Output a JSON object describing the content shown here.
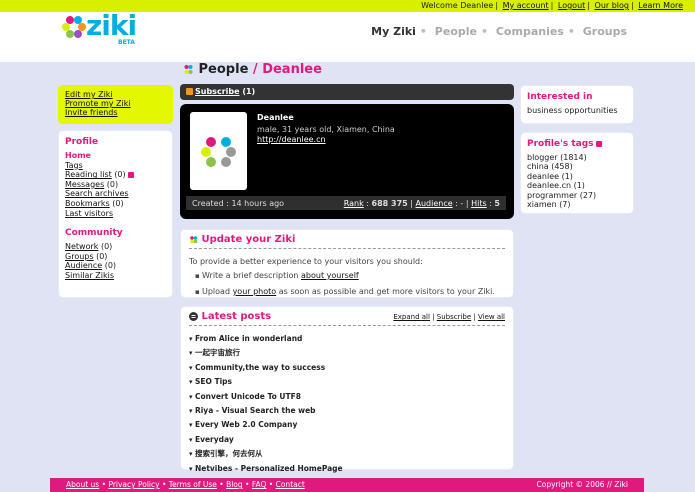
{
  "topbar": {
    "welcome": "Welcome Deanlee",
    "links": [
      "My account",
      "Logout",
      "Our blog",
      "Learn More"
    ]
  },
  "logo": {
    "text": "ziki",
    "beta": "BETA"
  },
  "nav": {
    "items": [
      "My Ziki",
      "People",
      "Companies",
      "Groups"
    ],
    "active": "My Ziki"
  },
  "sidebar_links": [
    "Edit my Ziki",
    "Promote my Ziki",
    "Invite friends"
  ],
  "profile_nav": {
    "title": "Profile",
    "items": [
      {
        "label": "Home",
        "count": ""
      },
      {
        "label": "Tags",
        "count": ""
      },
      {
        "label": "Reading list",
        "count": "(0)"
      },
      {
        "label": "Messages",
        "count": "(0)"
      },
      {
        "label": "Search archives",
        "count": ""
      },
      {
        "label": "Bookmarks",
        "count": "(0)"
      },
      {
        "label": "Last visitors",
        "count": ""
      }
    ]
  },
  "community_nav": {
    "title": "Community",
    "items": [
      {
        "label": "Network",
        "count": "(0)"
      },
      {
        "label": "Groups",
        "count": "(0)"
      },
      {
        "label": "Audience",
        "count": "(0)"
      },
      {
        "label": "Similar Zikis",
        "count": ""
      }
    ]
  },
  "page": {
    "title_prefix": "People",
    "sep": " / ",
    "title_name": "Deanlee"
  },
  "subscribe": {
    "label": "Subscribe",
    "count": "(1)"
  },
  "profile": {
    "name": "Deanlee",
    "description": "male, 31 years old, Xiamen, China",
    "url": "http://deanlee.cn",
    "created": "Created : 14 hours ago",
    "rank_label": "Rank",
    "rank_value": "688 375",
    "audience_label": "Audience",
    "audience_value": "-",
    "hits_label": "Hits",
    "hits_value": "5"
  },
  "update": {
    "title": "Update your Ziki",
    "intro": "To provide a better experience to your visitors you should:",
    "item1_pre": "Write a brief description",
    "item1_link": "about yourself",
    "item2_pre": "Upload",
    "item2_link": "your photo",
    "item2_post": "as soon as possible and get more visitors to your Ziki."
  },
  "posts": {
    "title": "Latest posts",
    "actions": [
      "Expand all",
      "Subscribe",
      "View all"
    ],
    "items": [
      "From Alice in wonderland",
      "一起宇宙旅行",
      "Community,the way to success",
      "SEO Tips",
      "Convert Unicode To UTF8",
      "Riya - Visual Search the web",
      "Every Web 2.0 Company",
      "Everyday",
      "搜索引擎，何去何从",
      "Netvibes - Personalized HomePage"
    ]
  },
  "interest": {
    "title": "Interested in",
    "value": "business opportunities"
  },
  "tags": {
    "title": "Profile's tags",
    "items": [
      "blogger (1814)",
      "china (458)",
      "deanlee (1)",
      "deanlee.cn (1)",
      "programmer (27)",
      "xiamen (7)"
    ]
  },
  "footer": {
    "links": [
      "About us",
      "Privacy Policy",
      "Terms of Use",
      "Blog",
      "FAQ",
      "Contact"
    ],
    "copyright": "Copyright © 2006 // Ziki"
  },
  "colors": {
    "accent": "#e0197e",
    "lime": "#d8f000",
    "blue": "#00aee0"
  }
}
